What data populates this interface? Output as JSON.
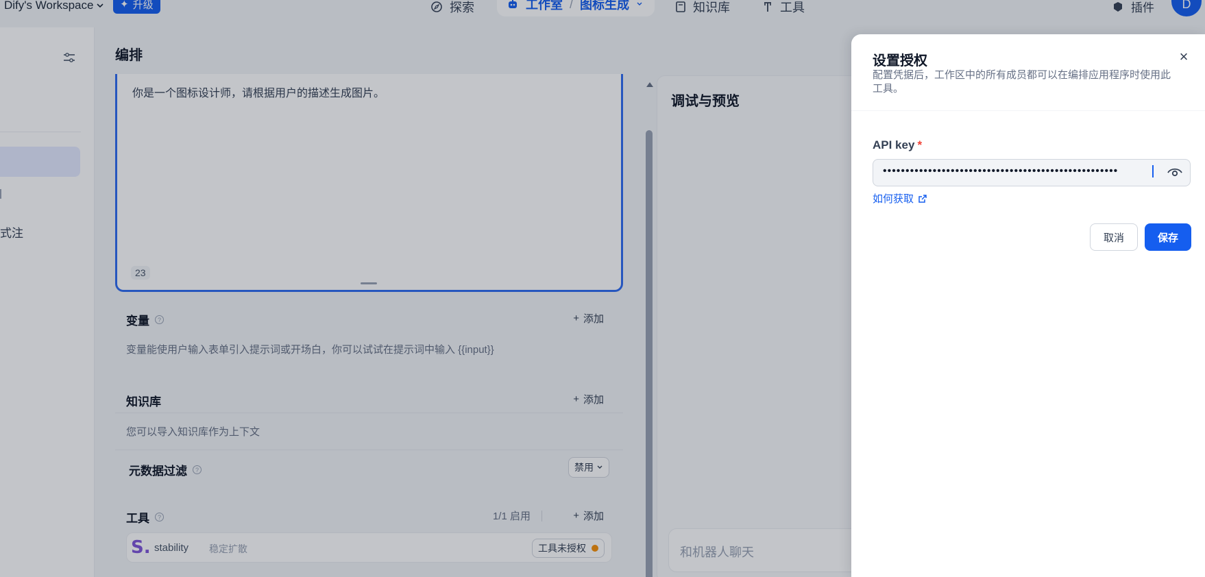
{
  "topbar": {
    "workspace_name": "Dify's Workspace",
    "upgrade_label": "升级",
    "nav_explore": "探索",
    "nav_studio": "工作室",
    "breadcrumb_sep": "/",
    "nav_app": "图标生成",
    "nav_knowledge": "知识库",
    "nav_tools": "工具",
    "nav_plugins": "插件",
    "avatar_letter": "D"
  },
  "sidebar": {
    "partial_text": "式注"
  },
  "main": {
    "title": "编排",
    "prompt_text": "你是一个图标设计师，请根据用户的描述生成图片。",
    "char_count": "23",
    "variables": {
      "title": "变量",
      "add_label": "添加",
      "desc": "变量能使用户输入表单引入提示词或开场白，你可以试试在提示词中输入 {{input}}"
    },
    "knowledge": {
      "title": "知识库",
      "add_label": "添加",
      "desc": "您可以导入知识库作为上下文",
      "metadata_filter_label": "元数据过滤",
      "metadata_filter_value": "禁用"
    },
    "tools": {
      "title": "工具",
      "count": "1/1 启用",
      "add_label": "添加",
      "items": [
        {
          "logo": "S.",
          "name": "stability",
          "subtitle": "稳定扩散",
          "status": "工具未授权"
        }
      ]
    }
  },
  "debug": {
    "title": "调试与预览",
    "chat_placeholder": "和机器人聊天"
  },
  "drawer": {
    "title": "设置授权",
    "desc": "配置凭据后，工作区中的所有成员都可以在编排应用程序时使用此工具。",
    "field_label": "API key",
    "required_mark": "*",
    "field_value": "••••••••••••••••••••••••••••••••••••••••••••••••••••",
    "help_link": "如何获取",
    "cancel_label": "取消",
    "save_label": "保存"
  },
  "colors": {
    "accent": "#155eef",
    "warning_dot": "#f79009",
    "required": "#f04438"
  }
}
